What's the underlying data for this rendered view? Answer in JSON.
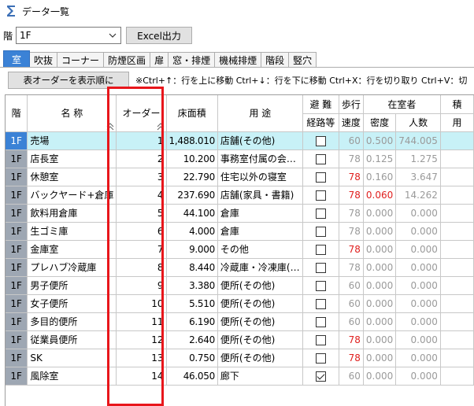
{
  "window": {
    "title": "データ一覧"
  },
  "floor": {
    "label": "階",
    "selected": "1F"
  },
  "toolbar": {
    "excel_label": "Excel出力"
  },
  "tabs": [
    "室",
    "吹抜",
    "コーナー",
    "防煙区画",
    "扉",
    "窓・排煙",
    "機械排煙",
    "階段",
    "竪穴"
  ],
  "order_bar": {
    "sort_label": "表オーダーを表示順に",
    "hint": "※Ctrl+↑：行を上に移動 Ctrl+↓：行を下に移動 Ctrl+X：行を切り取り Ctrl+V：切"
  },
  "headers": {
    "floor": "階",
    "name": "名 称",
    "order": "オーダー",
    "area": "床面積",
    "use": "用 途",
    "evac_top": "避 難",
    "evac_bottom": "経路等",
    "walk_top": "歩行",
    "walk_bottom": "速度",
    "occupants": "在室者",
    "density": "密度",
    "people": "人数",
    "extra_top": "積",
    "extra_bottom": "用"
  },
  "rows": [
    {
      "floor": "1F",
      "name": "売場",
      "order": "1",
      "area": "1,488.010",
      "use": "店舗(その他)",
      "evac": false,
      "speed": "60",
      "speed_red": false,
      "density": "0.500",
      "density_red": false,
      "people": "744.005",
      "selected": true
    },
    {
      "floor": "1F",
      "name": "店長室",
      "order": "2",
      "area": "10.200",
      "use": "事務室付属の会…",
      "evac": false,
      "speed": "78",
      "speed_red": false,
      "density": "0.125",
      "density_red": false,
      "people": "1.275",
      "selected": false
    },
    {
      "floor": "1F",
      "name": "休憩室",
      "order": "3",
      "area": "22.790",
      "use": "住宅以外の寝室",
      "evac": false,
      "speed": "78",
      "speed_red": true,
      "density": "0.160",
      "density_red": false,
      "people": "3.647",
      "selected": false
    },
    {
      "floor": "1F",
      "name": "バックヤード+倉庫",
      "order": "4",
      "area": "237.690",
      "use": "店舗(家具・書籍)",
      "evac": false,
      "speed": "78",
      "speed_red": true,
      "density": "0.060",
      "density_red": true,
      "people": "14.262",
      "selected": false
    },
    {
      "floor": "1F",
      "name": "飲料用倉庫",
      "order": "5",
      "area": "44.100",
      "use": "倉庫",
      "evac": false,
      "speed": "78",
      "speed_red": false,
      "density": "0.000",
      "density_red": false,
      "people": "0.000",
      "selected": false
    },
    {
      "floor": "1F",
      "name": "生ゴミ庫",
      "order": "6",
      "area": "4.000",
      "use": "倉庫",
      "evac": false,
      "speed": "78",
      "speed_red": false,
      "density": "0.000",
      "density_red": false,
      "people": "0.000",
      "selected": false
    },
    {
      "floor": "1F",
      "name": "金庫室",
      "order": "7",
      "area": "9.000",
      "use": "その他",
      "evac": false,
      "speed": "78",
      "speed_red": true,
      "density": "0.000",
      "density_red": false,
      "people": "0.000",
      "selected": false
    },
    {
      "floor": "1F",
      "name": "プレハブ冷蔵庫",
      "order": "8",
      "area": "8.440",
      "use": "冷蔵庫・冷凍庫(…",
      "evac": false,
      "speed": "78",
      "speed_red": false,
      "density": "0.000",
      "density_red": false,
      "people": "0.000",
      "selected": false
    },
    {
      "floor": "1F",
      "name": "男子便所",
      "order": "9",
      "area": "3.380",
      "use": "便所(その他)",
      "evac": false,
      "speed": "60",
      "speed_red": false,
      "density": "0.000",
      "density_red": false,
      "people": "0.000",
      "selected": false
    },
    {
      "floor": "1F",
      "name": "女子便所",
      "order": "10",
      "area": "5.510",
      "use": "便所(その他)",
      "evac": false,
      "speed": "60",
      "speed_red": false,
      "density": "0.000",
      "density_red": false,
      "people": "0.000",
      "selected": false
    },
    {
      "floor": "1F",
      "name": "多目的便所",
      "order": "11",
      "area": "6.190",
      "use": "便所(その他)",
      "evac": false,
      "speed": "60",
      "speed_red": false,
      "density": "0.000",
      "density_red": false,
      "people": "0.000",
      "selected": false
    },
    {
      "floor": "1F",
      "name": "従業員便所",
      "order": "12",
      "area": "2.640",
      "use": "便所(その他)",
      "evac": false,
      "speed": "78",
      "speed_red": true,
      "density": "0.000",
      "density_red": false,
      "people": "0.000",
      "selected": false
    },
    {
      "floor": "1F",
      "name": "SK",
      "order": "13",
      "area": "0.750",
      "use": "便所(その他)",
      "evac": false,
      "speed": "78",
      "speed_red": true,
      "density": "0.000",
      "density_red": false,
      "people": "0.000",
      "selected": false
    },
    {
      "floor": "1F",
      "name": "風除室",
      "order": "14",
      "area": "46.050",
      "use": "廊下",
      "evac": true,
      "speed": "60",
      "speed_red": false,
      "density": "0.000",
      "density_red": false,
      "people": "0.000",
      "selected": false
    }
  ],
  "colors": {
    "accent": "#3b82d6",
    "selected_row": "#c8f1f7",
    "warning": "#e0201f",
    "highlight_box": "#e8161b"
  }
}
